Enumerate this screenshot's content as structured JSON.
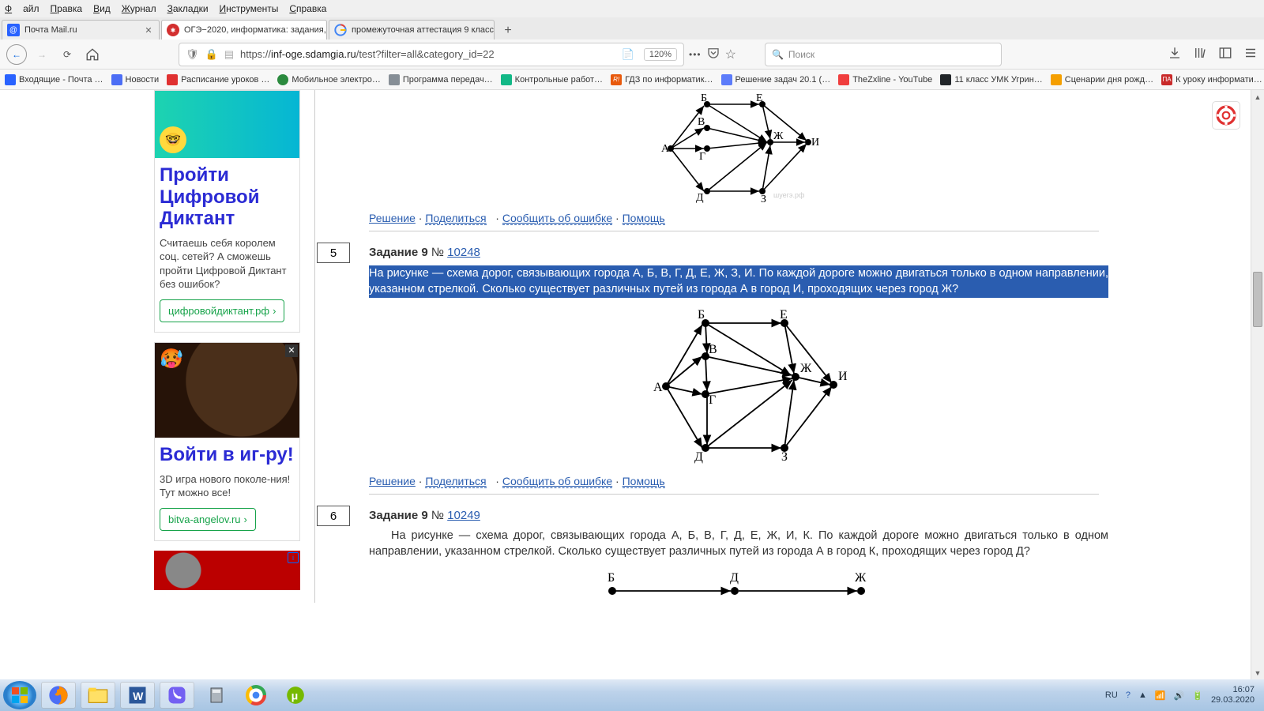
{
  "menubar": [
    "Файл",
    "Правка",
    "Вид",
    "Журнал",
    "Закладки",
    "Инструменты",
    "Справка"
  ],
  "tabs": [
    {
      "title": "Почта Mail.ru",
      "favColor": "#2962ff"
    },
    {
      "title": "ОГЭ−2020, информатика: задания,",
      "favColor": "#d32f2f",
      "active": true
    },
    {
      "title": "промежуточная аттестация 9 класс",
      "favColor": "#4285f4"
    }
  ],
  "url": {
    "prefix": "https://",
    "domain": "inf-oge.sdamgia.ru",
    "path": "/test?filter=all&category_id=22"
  },
  "zoom": "120%",
  "search_placeholder": "Поиск",
  "bookmarks": [
    {
      "label": "Входящие - Почта …",
      "color": "#2962ff"
    },
    {
      "label": "Новости",
      "color": "#4c6ef5"
    },
    {
      "label": "Расписание уроков …",
      "color": "#e03131"
    },
    {
      "label": "Мобильное электро…",
      "color": "#2b8a3e"
    },
    {
      "label": "Программа передач…",
      "color": "#868e96"
    },
    {
      "label": "Контрольные работ…",
      "color": "#12b886"
    },
    {
      "label": "ГДЗ по информатик…",
      "color": "#e8590c"
    },
    {
      "label": "Решение задач 20.1 (…",
      "color": "#5c7cfa"
    },
    {
      "label": "TheZxline - YouTube",
      "color": "#f03e3e"
    },
    {
      "label": "11 класс УМК Угрин…",
      "color": "#212529"
    },
    {
      "label": "Сценарии дня рожд…",
      "color": "#f59f00"
    },
    {
      "label": "К уроку информати…",
      "color": "#c92a2a"
    }
  ],
  "ad1": {
    "title": "Пройти Цифровой Диктант",
    "text": "Считаешь себя королем соц. сетей? А сможешь пройти Цифровой Диктант без ошибок?",
    "btn": "цифровойдиктант.рф"
  },
  "ad2": {
    "title": "Войти в иг-ру!",
    "text": "3D игра нового поколе-ния! Тут можно все!",
    "btn": "bitva-angelov.ru"
  },
  "actions": {
    "solution": "Решение",
    "share": "Поделиться",
    "report": "Сообщить об ошибке",
    "help": "Помощь",
    "sep": " · "
  },
  "task5": {
    "num": "5",
    "head_prefix": "Задание 9 ",
    "head_num": "№ ",
    "head_link": "10248",
    "text": "На рисунке — схема дорог, связывающих города А, Б, В, Г, Д, Е, Ж, З, И. По каждой дороге можно двигаться только в одном направлении, указанном стрелкой. Сколько существует различных путей из города А в город И, проходящих через город Ж?"
  },
  "task6": {
    "num": "6",
    "head_prefix": "Задание 9 ",
    "head_num": "№ ",
    "head_link": "10249",
    "text": "На рисунке — схема дорог, связывающих города А, Б, В, Г, Д, Е, Ж, И, К. По каждой дороге можно двигаться только в одном направлении, указанном стрелкой. Сколько существует различных путей из города А в город К, проходящих через город Д?"
  },
  "graph3": {
    "labels": [
      "Б",
      "Д",
      "Ж"
    ]
  },
  "tray": {
    "lang": "RU",
    "time": "16:07",
    "date": "29.03.2020"
  },
  "icons": {
    "dots": "…",
    "shield": "🛡",
    "lock": "🔒",
    "page": "📄",
    "star": "☆",
    "heart": "♡",
    "pocket": "⌄",
    "download": "⬇",
    "library": "|||\\",
    "menu": "≡",
    "chev": "›",
    "more": "»",
    "search": "🔍",
    "home": "⌂"
  }
}
